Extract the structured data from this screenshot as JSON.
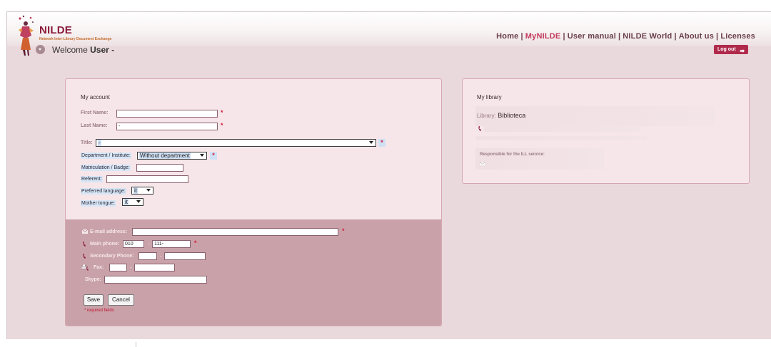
{
  "brand": {
    "title": "NILDE",
    "subtitle": "Network Inter-Library Document Exchange"
  },
  "nav": {
    "items": [
      {
        "label": "Home",
        "active": false
      },
      {
        "label": "MyNILDE",
        "active": true
      },
      {
        "label": "User manual",
        "active": false
      },
      {
        "label": "NILDE World",
        "active": false
      },
      {
        "label": "About us",
        "active": false
      },
      {
        "label": "Licenses",
        "active": false
      }
    ],
    "separator": "|"
  },
  "welcome": {
    "prefix": "Welcome",
    "user": "User -"
  },
  "logout_label": "Log out",
  "account": {
    "title": "My account",
    "first_name_label": "First Name:",
    "first_name_value": "",
    "last_name_label": "Last Name:",
    "last_name_value": "-",
    "title_label": "Title:",
    "title_value": "-",
    "department_label": "Department / Institute:",
    "department_value": "Without department",
    "matriculation_label": "Matriculation / Badge:",
    "matriculation_value": "",
    "referent_label": "Referent:",
    "referent_value": "",
    "preferred_language_label": "Preferred language:",
    "preferred_language_value": "it",
    "mother_tongue_label": "Mother tongue:",
    "mother_tongue_value": "it",
    "required_mark": "*"
  },
  "contact": {
    "email_label": "E-mail address:",
    "email_value": "",
    "main_phone_label": "Main phone:",
    "main_phone_prefix": "010",
    "main_phone_number": "111-",
    "secondary_phone_label": "Secondary Phone:",
    "secondary_phone_prefix": "",
    "secondary_phone_number": "",
    "fax_label": "Fax:",
    "fax_prefix": "",
    "fax_number": "",
    "skype_label": "Skype:",
    "skype_value": "",
    "dash": "-",
    "save_label": "Save",
    "cancel_label": "Cancel",
    "required_note": "* required fields"
  },
  "library": {
    "title": "My library",
    "library_label": "Library:",
    "library_value": "Biblioteca",
    "responsible_label": "Responsible for the ILL service:"
  },
  "colors": {
    "brand": "#8b1a3a",
    "accent": "#c23b5e",
    "logout_bg": "#b02a4c",
    "card_bg": "#f6e6e9",
    "contact_bg": "#c9a2a9",
    "page_bg": "#ead9dc"
  }
}
